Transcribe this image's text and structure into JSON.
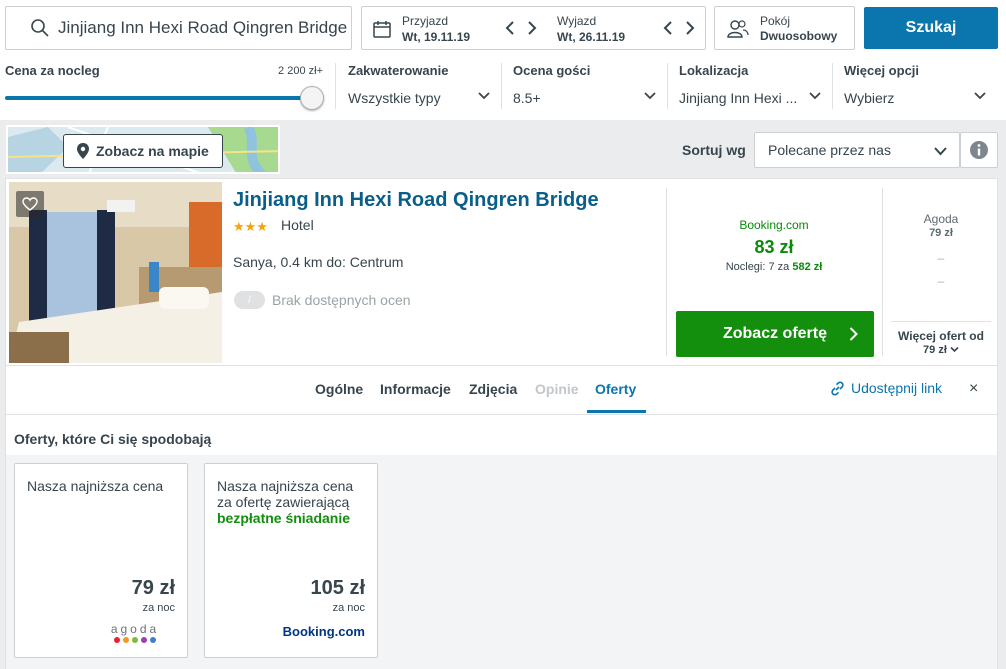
{
  "search": {
    "destination": "Jinjiang Inn Hexi Road Qingren Bridge",
    "button_label": "Szukaj"
  },
  "dates": {
    "checkin_label": "Przyjazd",
    "checkin_value": "Wt, 19.11.19",
    "checkout_label": "Wyjazd",
    "checkout_value": "Wt, 26.11.19"
  },
  "rooms": {
    "label": "Pokój",
    "value": "Dwuosobowy"
  },
  "filters": {
    "price": {
      "title": "Cena za nocleg",
      "max_label": "2 200 zł+",
      "slider_level": 1.0
    },
    "accommodation": {
      "title": "Zakwaterowanie",
      "value": "Wszystkie typy"
    },
    "rating": {
      "title": "Ocena gości",
      "value": "8.5+"
    },
    "location": {
      "title": "Lokalizacja",
      "value": "Jinjiang Inn Hexi ..."
    },
    "more": {
      "title": "Więcej opcji",
      "value": "Wybierz"
    }
  },
  "map": {
    "label": "Zobacz na mapie"
  },
  "sort": {
    "label": "Sortuj wg",
    "value": "Polecane przez nas"
  },
  "hotel": {
    "name": "Jinjiang Inn Hexi Road Qingren Bridge",
    "stars": "★★★",
    "type": "Hotel",
    "location": "Sanya, 0.4 km do: Centrum",
    "rating_badge": "/",
    "rating_text": "Brak dostępnych ocen"
  },
  "main_offer": {
    "provider": "Booking.com",
    "price": "83 zł",
    "nights_prefix": "Noclegi: 7 za",
    "nights_total": "582 zł",
    "button_label": "Zobacz ofertę"
  },
  "side_offer": {
    "provider": "Agoda",
    "price": "79 zł",
    "dash1": "–",
    "dash2": "–",
    "more_label": "Więcej ofert od",
    "more_price": "79 zł"
  },
  "tabs": [
    {
      "label": "Ogólne",
      "state": "normal"
    },
    {
      "label": "Informacje",
      "state": "normal"
    },
    {
      "label": "Zdjęcia",
      "state": "normal"
    },
    {
      "label": "Opinie",
      "state": "disabled"
    },
    {
      "label": "Oferty",
      "state": "active"
    }
  ],
  "share_label": "Udostępnij link",
  "close_label": "×",
  "offers": {
    "title": "Oferty, które Ci się spodobają",
    "cards": [
      {
        "desc": "Nasza najniższa cena",
        "highlight": "",
        "price": "79 zł",
        "per": "za noc",
        "logo": "agoda"
      },
      {
        "desc": "Nasza najniższa cena za ofertę zawierającą",
        "highlight": "bezpłatne śniadanie",
        "price": "105 zł",
        "per": "za noc",
        "logo": "Booking.com"
      }
    ]
  },
  "colors": {
    "brand_blue": "#0a76ad",
    "offer_green": "#138e0d",
    "star": "#f2a40f"
  },
  "icons": [
    "search-icon",
    "calendar-icon",
    "chevron-left-icon",
    "chevron-right-icon",
    "people-icon",
    "chevron-down-icon",
    "map-pin-icon",
    "info-icon",
    "heart-icon",
    "link-icon",
    "close-icon"
  ]
}
